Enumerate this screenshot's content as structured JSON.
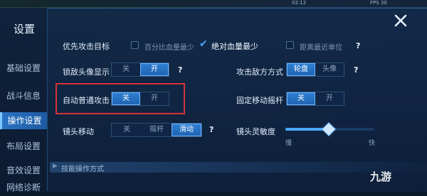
{
  "status_bar": {
    "time": "02:12",
    "fps": "FPS 30"
  },
  "sidebar": {
    "title": "设置",
    "items": [
      {
        "label": "基础设置"
      },
      {
        "label": "战斗信息"
      },
      {
        "label": "操作设置"
      },
      {
        "label": "布局设置"
      },
      {
        "label": "音效设置"
      },
      {
        "label": "网络诊断"
      }
    ],
    "active_index": 2
  },
  "target_priority": {
    "label": "优先攻击目标",
    "options": [
      {
        "label": "百分比血量最少",
        "checked": false
      },
      {
        "label": "绝对血量最少",
        "checked": true
      },
      {
        "label": "距离最近单位",
        "checked": false
      }
    ]
  },
  "lock_portrait": {
    "label": "锁敌头像显示",
    "options": [
      "关",
      "开"
    ],
    "selected": "开"
  },
  "attack_enemy_mode": {
    "label": "攻击敌方方式",
    "options": [
      "轮盘",
      "头像"
    ],
    "selected": "轮盘"
  },
  "auto_attack": {
    "label": "自动普通攻击",
    "options": [
      "关",
      "开"
    ],
    "selected": "关"
  },
  "fixed_joystick": {
    "label": "固定移动摇杆",
    "options": [
      "关",
      "开"
    ],
    "selected": "关"
  },
  "camera_move": {
    "label": "镜头移动",
    "options": [
      "关",
      "摇杆",
      "滑动"
    ],
    "selected": "滑动"
  },
  "camera_sensitivity": {
    "label": "镜头灵敏度",
    "min_label": "慢",
    "max_label": "快",
    "value": 0.48
  },
  "skill_section": {
    "label": "技能操作方式"
  },
  "watermark": {
    "text": "九游"
  },
  "colors": {
    "accent": "#2f7fd3",
    "highlight": "#d8323a"
  }
}
